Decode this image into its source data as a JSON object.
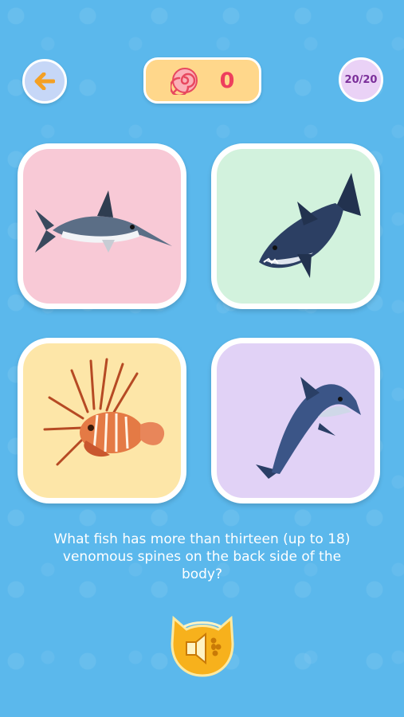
{
  "header": {
    "back_icon": "arrow-left-icon",
    "score_icon": "candy-icon",
    "score": "0",
    "progress": "20/20"
  },
  "cards": [
    {
      "animal": "swordfish",
      "background": "#f8c9d6"
    },
    {
      "animal": "shark",
      "background": "#d2f2dd"
    },
    {
      "animal": "lionfish",
      "background": "#fde6a8"
    },
    {
      "animal": "dolphin",
      "background": "#e1d2f6"
    }
  ],
  "question": "What fish has more than thirteen (up to 18) venomous spines on the back side of the body?",
  "sound_button": {
    "icon": "speaker-icon"
  },
  "colors": {
    "background": "#5bb8ec",
    "accent_orange": "#f4a024",
    "score_red": "#ee3f5d"
  }
}
